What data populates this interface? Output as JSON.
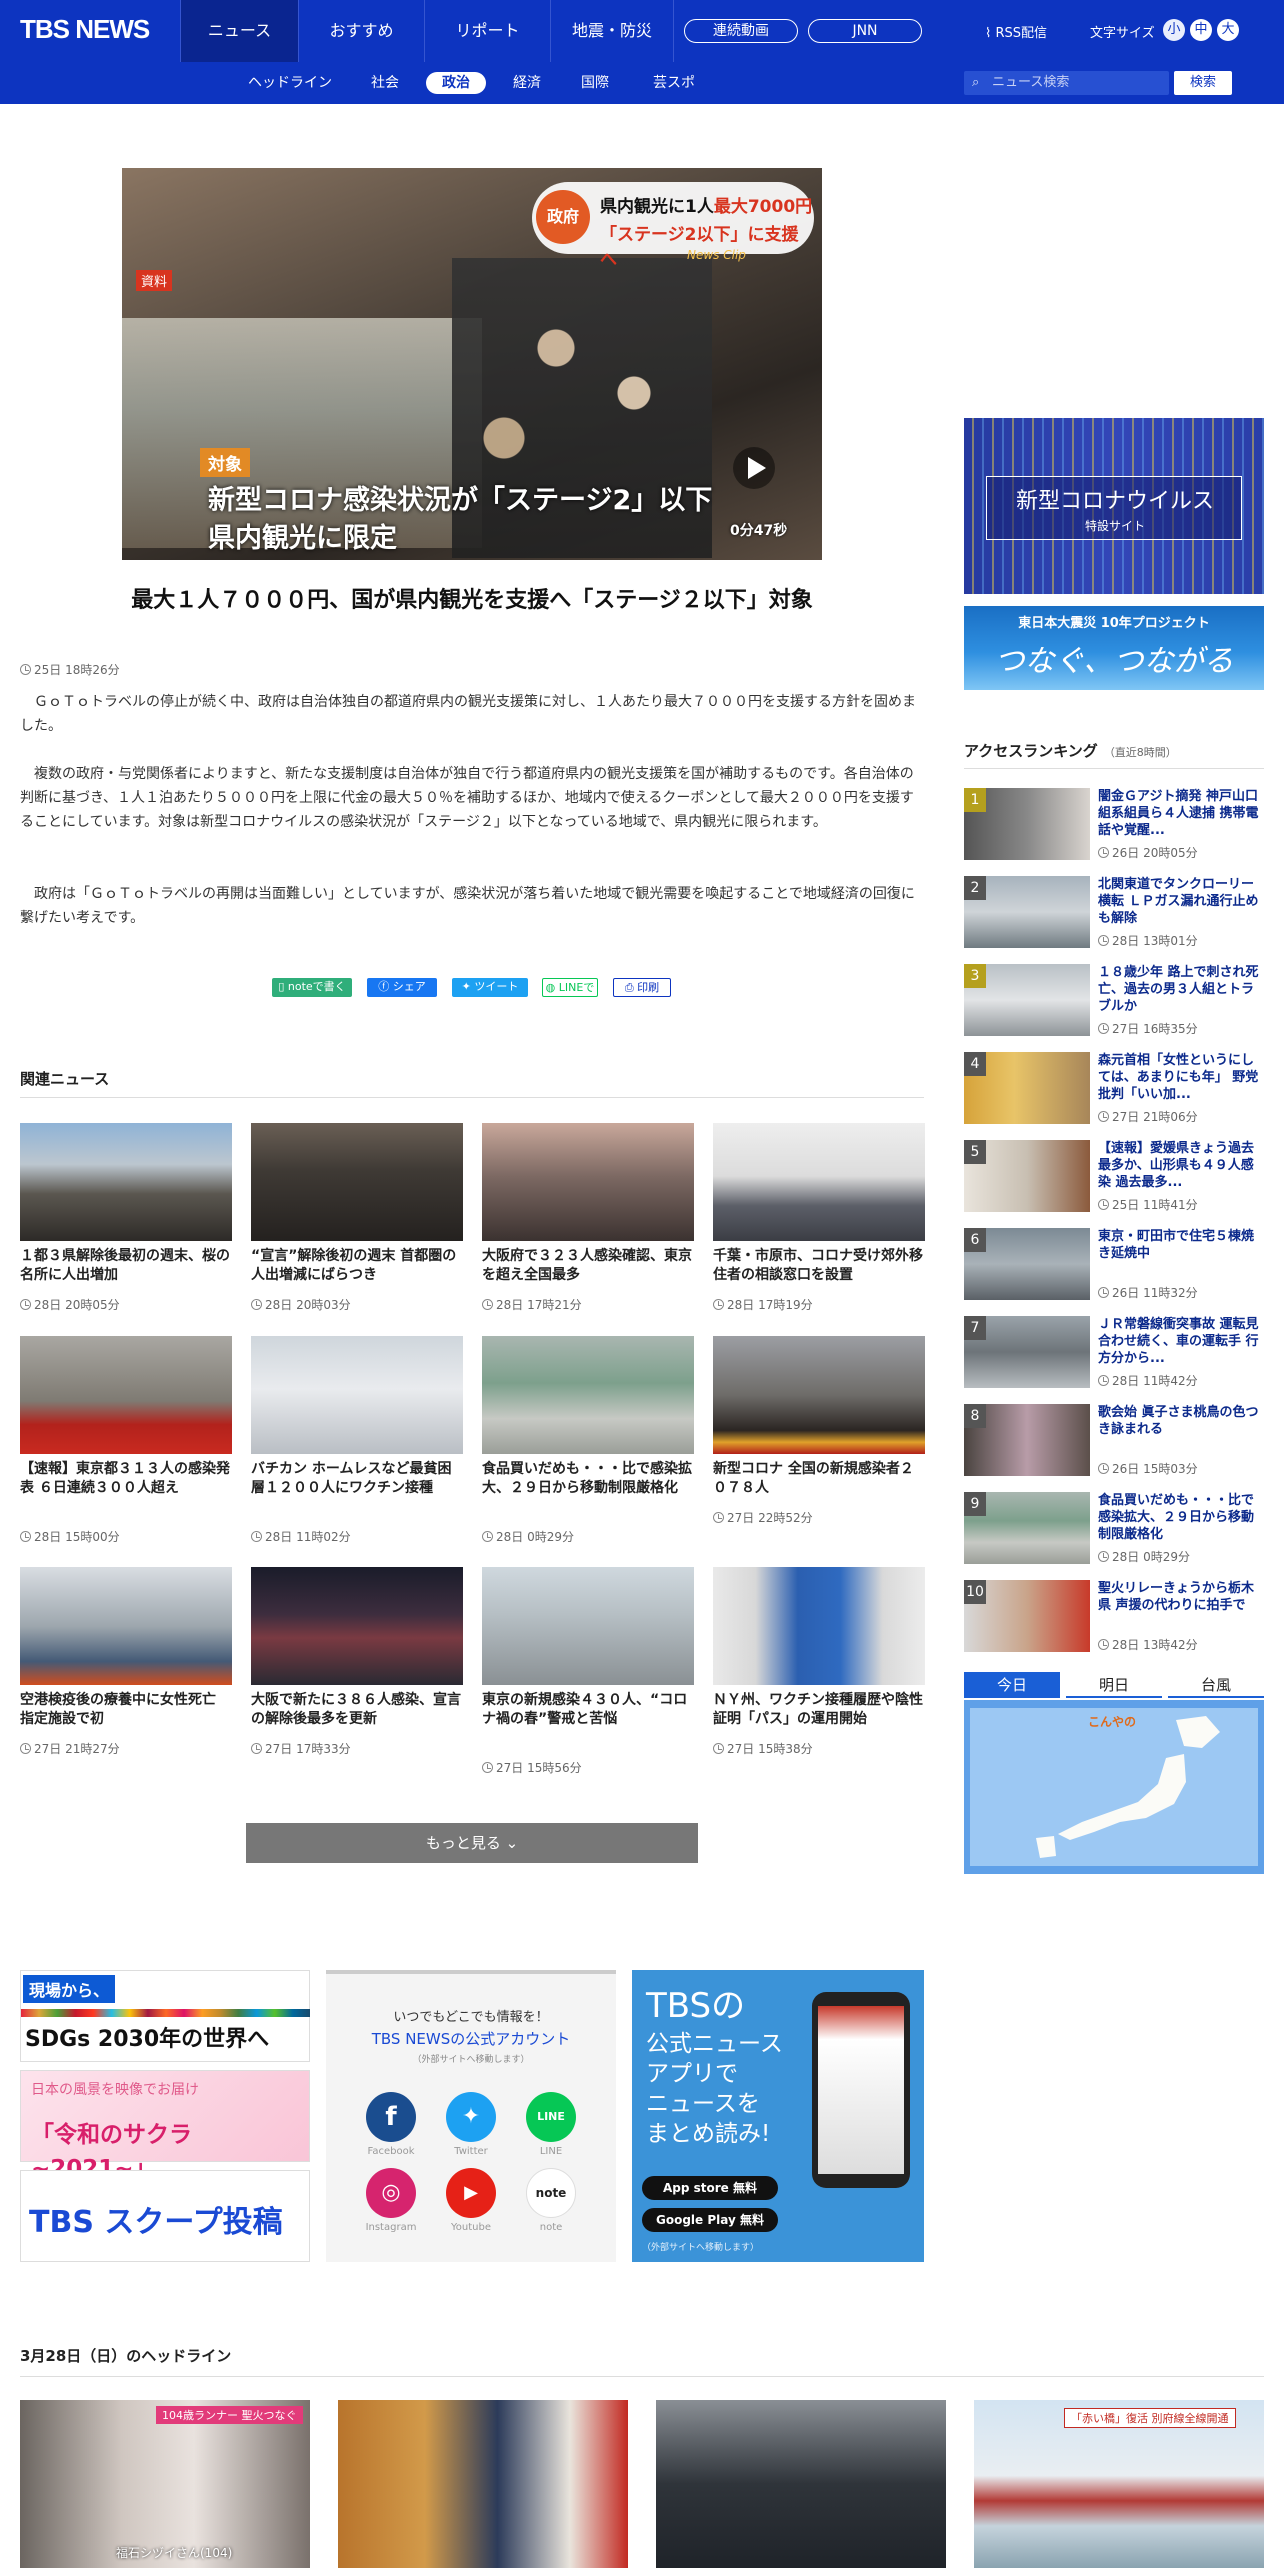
{
  "header": {
    "logo": "TBS NEWS",
    "nav": [
      "ニュース",
      "おすすめ",
      "リポート",
      "地震・防災"
    ],
    "pills": [
      "連続動画",
      "JNN"
    ],
    "rss": "RSS配信",
    "font_size_label": "文字サイズ",
    "font_sizes": [
      "小",
      "中",
      "大"
    ]
  },
  "subnav": {
    "items": [
      "ヘッドライン",
      "社会",
      "政治",
      "経済",
      "国際",
      "芸スポ"
    ],
    "active": "政治",
    "search_placeholder": "ニュース検索",
    "search_button": "検索"
  },
  "video": {
    "badge_gov": "政府",
    "badge_line1_prefix": "県内観光に1人",
    "badge_line1_highlight": "最大7000円",
    "badge_line2": "「ステージ2以下」に支援へ",
    "clip": "News Clip",
    "tag_shiryo": "資料",
    "tag_target": "対象",
    "caption1": "新型コロナ感染状況が「ステージ2」以下",
    "caption2": "県内観光に限定",
    "duration": "0分47秒"
  },
  "article": {
    "headline": "最大１人７０００円、国が県内観光を支援へ「ステージ２以下」対象",
    "timestamp": "25日 18時26分",
    "paragraphs": [
      "　ＧｏＴｏトラベルの停止が続く中、政府は自治体独自の都道府県内の観光支援策に対し、１人あたり最大７０００円を支援する方針を固めました。",
      "　複数の政府・与党関係者によりますと、新たな支援制度は自治体が独自で行う都道府県内の観光支援策を国が補助するものです。各自治体の判断に基づき、１人１泊あたり５０００円を上限に代金の最大５０％を補助するほか、地域内で使えるクーポンとして最大２０００円を支援することにしています。対象は新型コロナウイルスの感染状況が「ステージ２」以下となっている地域で、県内観光に限られます。",
      "　政府は「ＧｏＴｏトラベルの再開は当面難しい」としていますが、感染状況が落ち着いた地域で観光需要を喚起することで地域経済の回復に繋げたい考えです。"
    ],
    "share": [
      "noteで書く",
      "シェア",
      "ツイート",
      "LINEで",
      "印刷"
    ]
  },
  "related": {
    "title": "関連ニュース",
    "items": [
      {
        "title": "１都３県解除後最初の週末、桜の名所に人出増加",
        "time": "28日 20時05分"
      },
      {
        "title": "“宣言”解除後初の週末 首都圏の人出増減にばらつき",
        "time": "28日 20時03分"
      },
      {
        "title": "大阪府で３２３人感染確認、東京を超え全国最多",
        "time": "28日 17時21分"
      },
      {
        "title": "千葉・市原市、コロナ受け郊外移住者の相談窓口を設置",
        "time": "28日 17時19分"
      },
      {
        "title": "【速報】東京都３１３人の感染発表 ６日連続３００人超え",
        "time": "28日 15時00分"
      },
      {
        "title": "バチカン ホームレスなど最貧困層１２００人にワクチン接種",
        "time": "28日 11時02分"
      },
      {
        "title": "食品買いだめも・・・比で感染拡大、２９日から移動制限厳格化",
        "time": "28日 0時29分"
      },
      {
        "title": "新型コロナ 全国の新規感染者２０７８人",
        "time": "27日 22時52分"
      },
      {
        "title": "空港検疫後の療養中に女性死亡 指定施設で初",
        "time": "27日 21時27分"
      },
      {
        "title": "大阪で新たに３８６人感染、宣言の解除後最多を更新",
        "time": "27日 17時33分"
      },
      {
        "title": "東京の新規感染４３０人、“コロナ禍の春”警戒と苦悩",
        "time": "27日 15時56分"
      },
      {
        "title": "ＮＹ州、ワクチン接種履歴や陰性証明「パス」の運用開始",
        "time": "27日 15時38分"
      }
    ],
    "more": "もっと見る"
  },
  "sidebar": {
    "banner1_title": "新型コロナウイルス",
    "banner1_sub": "特設サイト",
    "banner2_top": "東日本大震災 10年プロジェクト",
    "banner2_main": "つなぐ、つながる",
    "ranking_title": "アクセスランキング",
    "ranking_sub": "（直近8時間）",
    "ranking": [
      {
        "num": "1",
        "title": "闇金Ｇアジト摘発 神戸山口組系組員ら４人逮捕 携帯電話や覚醒...",
        "time": "26日 20時05分"
      },
      {
        "num": "2",
        "title": "北関東道でタンクローリー横転 ＬＰガス漏れ通行止めも解除",
        "time": "28日 13時01分"
      },
      {
        "num": "3",
        "title": "１８歳少年 路上で刺され死亡、過去の男３人組とトラブルか",
        "time": "27日 16時35分"
      },
      {
        "num": "4",
        "title": "森元首相「女性というにしては、あまりにも年」 野党批判「いい加...",
        "time": "27日 21時06分"
      },
      {
        "num": "5",
        "title": "【速報】愛媛県きょう過去最多か、山形県も４９人感染 過去最多...",
        "time": "25日 11時41分"
      },
      {
        "num": "6",
        "title": "東京・町田市で住宅５棟焼き延焼中",
        "time": "26日 11時32分"
      },
      {
        "num": "7",
        "title": "ＪＲ常磐線衝突事故 運転見合わせ続く、車の運転手 行方分から...",
        "time": "28日 11時42分"
      },
      {
        "num": "8",
        "title": "歌会始 眞子さま桃鳥の色つき詠まれる",
        "time": "26日 15時03分"
      },
      {
        "num": "9",
        "title": "食品買いだめも・・・比で感染拡大、２９日から移動制限厳格化",
        "time": "28日 0時29分"
      },
      {
        "num": "10",
        "title": "聖火リレーきょうから栃木県 声援の代わりに拍手で",
        "time": "28日 13時42分"
      }
    ],
    "weather_tabs": [
      "今日",
      "明日",
      "台風"
    ],
    "weather_badge": "こんやの"
  },
  "banners": {
    "sdgs_top": "現場から、",
    "sdgs_main": "SDGs 2030年の世界へ",
    "sakura_top": "日本の風景を映像でお届け",
    "sakura_main": "「令和のサクラ ~2021~」",
    "scoop": "TBS スクープ投稿",
    "sns_title": "いつでもどこでも情報を！",
    "sns_sub": "TBS NEWSの公式アカウント",
    "sns_note": "（外部サイトへ移動します）",
    "sns_labels": [
      "Facebook",
      "Twitter",
      "LINE",
      "Instagram",
      "Youtube",
      "note"
    ],
    "app_lines": [
      "TBSの",
      "公式ニュース",
      "アプリで",
      "ニュースを",
      "まとめ読み!"
    ],
    "app_store": "App store 無料",
    "google_play": "Google Play 無料",
    "app_note": "（外部サイトへ移動します）"
  },
  "headlines": {
    "title": "3月28日（日）のヘッドライン",
    "thumb1_caption": "福石シヅイさん(104)",
    "thumb1_tag": "104歳ランナー 聖火つなぐ",
    "thumb4_tag": "「赤い橋」復活 別府線全線開通"
  },
  "colors": {
    "brand": "#0d34c0",
    "rank_top": "#b5a01e",
    "weather_tab": "#1a5fd6"
  }
}
